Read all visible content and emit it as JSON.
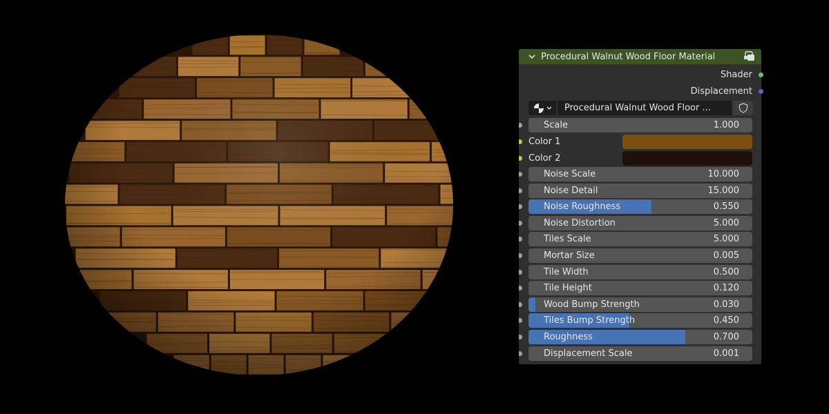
{
  "node": {
    "title": "Procedural Walnut Wood Floor Material",
    "header_color": "#3a5424",
    "outputs": [
      {
        "label": "Shader",
        "socket_color": "#63c763"
      },
      {
        "label": "Displacement",
        "socket_color": "#6363c7"
      }
    ],
    "group_name": "Procedural Walnut Wood Floor ...",
    "inputs": [
      {
        "label": "Scale",
        "value": "1.000",
        "fill": 0
      },
      {
        "label": "Noise Scale",
        "value": "10.000",
        "fill": 0
      },
      {
        "label": "Noise Detail",
        "value": "15.000",
        "fill": 0
      },
      {
        "label": "Noise Roughness",
        "value": "0.550",
        "fill": 0.55
      },
      {
        "label": "Noise Distortion",
        "value": "5.000",
        "fill": 0
      },
      {
        "label": "Tiles Scale",
        "value": "5.000",
        "fill": 0
      },
      {
        "label": "Mortar Size",
        "value": "0.005",
        "fill": 0
      },
      {
        "label": "Tile Width",
        "value": "0.500",
        "fill": 0
      },
      {
        "label": "Tile Height",
        "value": "0.120",
        "fill": 0
      },
      {
        "label": "Wood  Bump Strength",
        "value": "0.030",
        "fill": 0.03
      },
      {
        "label": "Tiles Bump Strength",
        "value": "0.450",
        "fill": 0.45
      },
      {
        "label": "Roughness",
        "value": "0.700",
        "fill": 0.7
      },
      {
        "label": "Displacement Scale",
        "value": "0.001",
        "fill": 0
      }
    ],
    "colors": [
      {
        "label": "Color 1",
        "color": "#7a5010"
      },
      {
        "label": "Color 2",
        "color": "#1e1108"
      }
    ],
    "accent_color": "#4772b3"
  },
  "preview": {
    "colors": {
      "wood_base": "#8a5a25",
      "wood_light": "#b07a3a",
      "wood_dark": "#4a2a10",
      "mortar": "#2a1608"
    }
  }
}
